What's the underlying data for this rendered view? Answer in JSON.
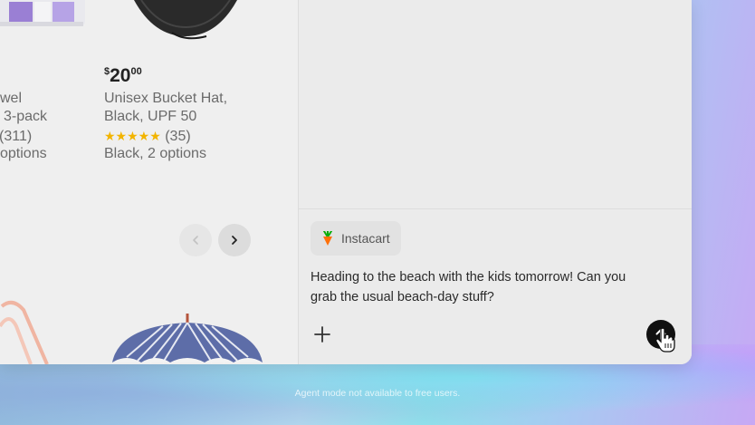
{
  "products": [
    {
      "name_lines": [
        "wel",
        "3-pack"
      ],
      "rating_count": "(311)",
      "options": "options"
    },
    {
      "price_dollars": "20",
      "price_cents": "00",
      "price_symbol": "$",
      "name_lines": [
        "Unisex Bucket Hat,",
        "Black, UPF 50"
      ],
      "stars": "★★★★★",
      "rating_count": "(35)",
      "options": "Black, 2 options"
    }
  ],
  "nav": {
    "prev_icon": "chevron-left-icon",
    "next_icon": "chevron-right-icon"
  },
  "chat": {
    "chip_label": "Instacart",
    "chip_icon": "carrot-icon",
    "message": "Heading to the beach with the kids tomorrow! Can you grab the usual beach-day stuff?",
    "plus_icon": "plus-icon",
    "send_icon": "arrow-up-icon"
  },
  "footer_note": "Agent mode not available to free users.",
  "colors": {
    "star": "#f2b400",
    "send_button": "#111111",
    "carrot_orange": "#ff7009",
    "carrot_green": "#0aad0a"
  }
}
